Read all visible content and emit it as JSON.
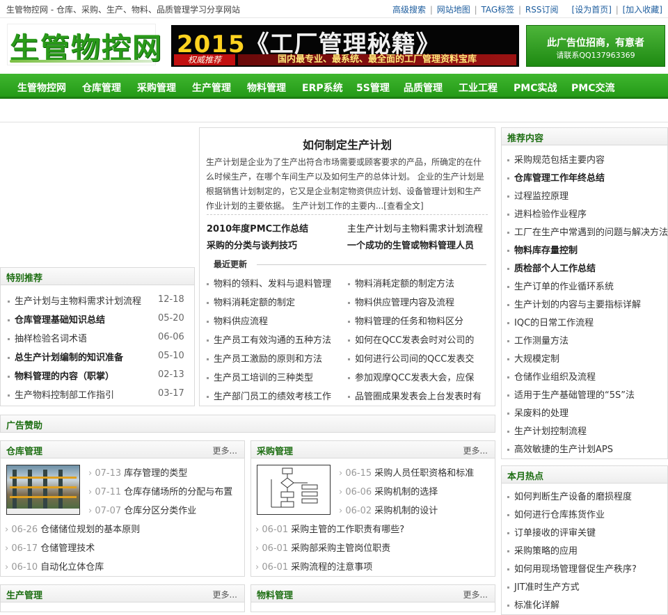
{
  "topbar": {
    "slogan": "生管物控网 - 仓库、采购、生产、物料、品质管理学习分享网站",
    "links": [
      "高级搜索",
      "网站地图",
      "TAG标签",
      "RSS订阅"
    ],
    "sep": "|",
    "home": "[设为首页]",
    "fav": "[加入收藏]"
  },
  "header": {
    "logo": "生管物控网",
    "banner1_year": "2015",
    "banner1_title": "《工厂管理秘籍》",
    "banner1_tag": "权威推荐",
    "banner1_sub": "国内最专业、最系统、最全面的工厂管理资料宝库",
    "banner2_l1": "此广告位招商，有意者",
    "banner2_l2": "请联系QQ137963369"
  },
  "nav": [
    "生管物控网",
    "仓库管理",
    "采购管理",
    "生产管理",
    "物料管理",
    "ERP系统",
    "5S管理",
    "品质管理",
    "工业工程",
    "PMC实战",
    "PMC交流"
  ],
  "special": {
    "title": "特别推荐",
    "items": [
      {
        "t": "生产计划与主物料需求计划流程",
        "d": "12-18",
        "b": false
      },
      {
        "t": "仓库管理基础知识总结",
        "d": "05-20",
        "b": true
      },
      {
        "t": "抽样检验名词术语",
        "d": "06-06",
        "b": false
      },
      {
        "t": "总生产计划编制的知识准备",
        "d": "05-10",
        "b": true
      },
      {
        "t": "物料管理的内容（职掌）",
        "d": "02-13",
        "b": true
      },
      {
        "t": "生产物料控制部工作指引",
        "d": "03-17",
        "b": false
      }
    ]
  },
  "article": {
    "title": "如何制定生产计划",
    "body": "生产计划是企业为了生产出符合市场需要或顾客要求的产品，所确定的在什么时候生产，在哪个车间生产以及如何生产的总体计划。 企业的生产计划是根据销售计划制定的，它又是企业制定物资供应计划、设备管理计划和生产作业计划的主要依据。 生产计划工作的主要内...[查看全文]",
    "highlights": [
      "2010年度PMC工作总结",
      "主生产计划与主物料需求计划流程",
      "采购的分类与谈判技巧",
      "一个成功的生管或物料管理人员"
    ],
    "latest_title": "最近更新",
    "latest": [
      "物料的领料、发料与退料管理",
      "物料消耗定额的制定方法",
      "物料消耗定额的制定",
      "物料供应管理内容及流程",
      "物料供应流程",
      "物料管理的任务和物料区分",
      "生产员工有效沟通的五种方法",
      "如何在QCC发表会时对公司的",
      "生产员工激励的原则和方法",
      "如何进行公司间的QCC发表交",
      "生产员工培训的三种类型",
      "参加观摩QCC发表大会，应保",
      "生产部门员工的绩效考核工作",
      "品管圈成果发表会上台发表时有"
    ]
  },
  "ad": {
    "title": "广告赞助"
  },
  "warehouse": {
    "title": "仓库管理",
    "more": "更多...",
    "top": [
      {
        "d": "07-13",
        "t": "库存管理的类型"
      },
      {
        "d": "07-11",
        "t": "仓库存储场所的分配与布置"
      },
      {
        "d": "07-07",
        "t": "仓库分区分类作业"
      }
    ],
    "bottom": [
      {
        "d": "06-26",
        "t": "仓储储位规划的基本原则"
      },
      {
        "d": "06-17",
        "t": "仓储管理技术"
      },
      {
        "d": "06-10",
        "t": "自动化立体仓库"
      }
    ]
  },
  "purchase": {
    "title": "采购管理",
    "more": "更多...",
    "top": [
      {
        "d": "06-15",
        "t": "采购人员任职资格和标准"
      },
      {
        "d": "06-06",
        "t": "采购机制的选择"
      },
      {
        "d": "06-02",
        "t": "采购机制的设计"
      }
    ],
    "bottom": [
      {
        "d": "06-01",
        "t": "采购主管的工作职责有哪些?"
      },
      {
        "d": "06-01",
        "t": "采购部采购主管岗位职责"
      },
      {
        "d": "06-01",
        "t": "采购流程的注意事项"
      }
    ]
  },
  "production": {
    "title": "生产管理",
    "more": "更多..."
  },
  "material": {
    "title": "物料管理",
    "more": "更多..."
  },
  "recommend": {
    "title": "推荐内容",
    "items": [
      {
        "t": "采购规范包括主要内容",
        "b": false
      },
      {
        "t": "仓库管理工作年终总结",
        "b": true
      },
      {
        "t": "过程监控原理",
        "b": false
      },
      {
        "t": "进料检验作业程序",
        "b": false
      },
      {
        "t": "工厂在生产中常遇到的问题与解决方法",
        "b": false
      },
      {
        "t": "物料库存量控制",
        "b": true
      },
      {
        "t": "质检部个人工作总结",
        "b": true
      },
      {
        "t": "生产订单的作业循环系统",
        "b": false
      },
      {
        "t": "生产计划的内容与主要指标详解",
        "b": false
      },
      {
        "t": "IQC的日常工作流程",
        "b": false
      },
      {
        "t": "工作测量方法",
        "b": false
      },
      {
        "t": "大规模定制",
        "b": false
      },
      {
        "t": "仓储作业组织及流程",
        "b": false
      },
      {
        "t": "适用于生产基础管理的“5S”法",
        "b": false
      },
      {
        "t": "呆废料的处理",
        "b": false
      },
      {
        "t": "生产计划控制流程",
        "b": false
      },
      {
        "t": "高效敏捷的生产计划APS",
        "b": false
      }
    ]
  },
  "hot": {
    "title": "本月热点",
    "items": [
      "如何判断生产设备的磨损程度",
      "如何进行仓库拣货作业",
      "订单接收的评审关键",
      "采购策略的应用",
      "如何用现场管理督促生产秩序?",
      "JIT准时生产方式",
      "标准化详解"
    ]
  }
}
